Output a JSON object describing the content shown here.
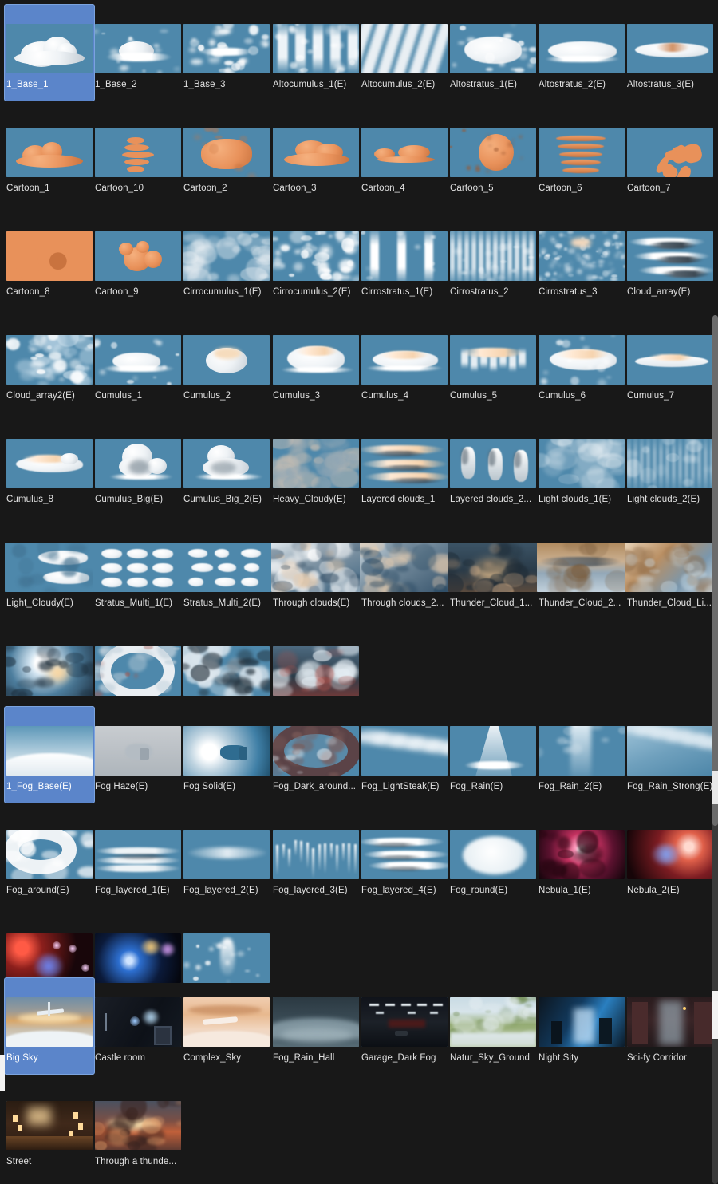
{
  "app": {
    "view": "asset-grid",
    "background_color": "#181818",
    "selection_color": "#5b85ca",
    "label_color": "#e2e2e2",
    "thumbnail_sky_color": "#4e88ab"
  },
  "scrollbar": {
    "visible": true,
    "track_color": "#3a3a3a",
    "thumb_color": "#6b6b6b"
  },
  "sections": [
    {
      "name": "clouds",
      "rows": [
        {
          "items": [
            {
              "label": "1_Base_1",
              "selected": true,
              "art": "cumulus-white"
            },
            {
              "label": "1_Base_2",
              "selected": false,
              "art": "cumulus-flat"
            },
            {
              "label": "1_Base_3",
              "selected": false,
              "art": "cumulus-wispy"
            },
            {
              "label": "Altocumulus_1(E)",
              "selected": false,
              "art": "altocumulus-streaks"
            },
            {
              "label": "Altocumulus_2(E)",
              "selected": false,
              "art": "altocumulus-diag"
            },
            {
              "label": "Altostratus_1(E)",
              "selected": false,
              "art": "altostratus-puff"
            },
            {
              "label": "Altostratus_2(E)",
              "selected": false,
              "art": "altostratus-long"
            },
            {
              "label": "Altostratus_3(E)",
              "selected": false,
              "art": "altostratus-warm"
            }
          ]
        },
        {
          "items": [
            {
              "label": "Cartoon_1",
              "selected": false,
              "art": "cartoon-lumps"
            },
            {
              "label": "Cartoon_10",
              "selected": false,
              "art": "cartoon-stack-ball"
            },
            {
              "label": "Cartoon_2",
              "selected": false,
              "art": "cartoon-mass"
            },
            {
              "label": "Cartoon_3",
              "selected": false,
              "art": "cartoon-rolls"
            },
            {
              "label": "Cartoon_4",
              "selected": false,
              "art": "cartoon-flat"
            },
            {
              "label": "Cartoon_5",
              "selected": false,
              "art": "cartoon-sphere"
            },
            {
              "label": "Cartoon_6",
              "selected": false,
              "art": "cartoon-layers"
            },
            {
              "label": "Cartoon_7",
              "selected": false,
              "art": "cartoon-tangle"
            }
          ]
        },
        {
          "items": [
            {
              "label": "Cartoon_8",
              "selected": false,
              "art": "cartoon-swirl"
            },
            {
              "label": "Cartoon_9",
              "selected": false,
              "art": "cartoon-bubbles"
            },
            {
              "label": "Cirrocumulus_1(E)",
              "selected": false,
              "art": "cirro-soft"
            },
            {
              "label": "Cirrocumulus_2(E)",
              "selected": false,
              "art": "cirro-patchy"
            },
            {
              "label": "Cirrostratus_1(E)",
              "selected": false,
              "art": "cirro-vertical3"
            },
            {
              "label": "Cirrostratus_2",
              "selected": false,
              "art": "cirro-ripple"
            },
            {
              "label": "Cirrostratus_3",
              "selected": false,
              "art": "cirro-fine"
            },
            {
              "label": "Cloud_array(E)",
              "selected": false,
              "art": "cloud-array"
            }
          ]
        },
        {
          "items": [
            {
              "label": "Cloud_array2(E)",
              "selected": false,
              "art": "cloud-array2"
            },
            {
              "label": "Cumulus_1",
              "selected": false,
              "art": "cumulus-low"
            },
            {
              "label": "Cumulus_2",
              "selected": false,
              "art": "cumulus-round"
            },
            {
              "label": "Cumulus_3",
              "selected": false,
              "art": "cumulus-fluffy"
            },
            {
              "label": "Cumulus_4",
              "selected": false,
              "art": "cumulus-wide"
            },
            {
              "label": "Cumulus_5",
              "selected": false,
              "art": "cumulus-tufted"
            },
            {
              "label": "Cumulus_6",
              "selected": false,
              "art": "cumulus-broad"
            },
            {
              "label": "Cumulus_7",
              "selected": false,
              "art": "cumulus-lens"
            }
          ]
        },
        {
          "items": [
            {
              "label": "Cumulus_8",
              "selected": false,
              "art": "cumulus-warm-flat"
            },
            {
              "label": "Cumulus_Big(E)",
              "selected": false,
              "art": "cumulus-tower"
            },
            {
              "label": "Cumulus_Big_2(E)",
              "selected": false,
              "art": "cumulus-tower2"
            },
            {
              "label": "Heavy_Cloudy(E)",
              "selected": false,
              "art": "heavy-cloudy"
            },
            {
              "label": "Layered clouds_1",
              "selected": false,
              "art": "layered-1"
            },
            {
              "label": "Layered clouds_2...",
              "selected": false,
              "art": "layered-2"
            },
            {
              "label": "Light clouds_1(E)",
              "selected": false,
              "art": "light-clouds-1"
            },
            {
              "label": "Light clouds_2(E)",
              "selected": false,
              "art": "light-clouds-2"
            }
          ]
        },
        {
          "items": [
            {
              "label": "Light_Cloudy(E)",
              "selected": false,
              "art": "light-cloudy"
            },
            {
              "label": "Stratus_Multi_1(E)",
              "selected": false,
              "art": "stratus-multi-1"
            },
            {
              "label": "Stratus_Multi_2(E)",
              "selected": false,
              "art": "stratus-multi-2"
            },
            {
              "label": "Through clouds(E)",
              "selected": false,
              "art": "through-clouds"
            },
            {
              "label": "Through clouds_2...",
              "selected": false,
              "art": "through-clouds-2"
            },
            {
              "label": "Thunder_Cloud_1...",
              "selected": false,
              "art": "thunder-1"
            },
            {
              "label": "Thunder_Cloud_2...",
              "selected": false,
              "art": "thunder-2"
            },
            {
              "label": "Thunder_Cloud_Li...",
              "selected": false,
              "art": "thunder-light"
            }
          ]
        },
        {
          "no_labels": true,
          "items": [
            {
              "label": "",
              "selected": false,
              "art": "sun-burst"
            },
            {
              "label": "",
              "selected": false,
              "art": "fog-ring"
            },
            {
              "label": "",
              "selected": false,
              "art": "fog-holes"
            },
            {
              "label": "",
              "selected": false,
              "art": "fog-red-glow"
            }
          ]
        }
      ]
    },
    {
      "name": "fog",
      "rows": [
        {
          "items": [
            {
              "label": "1_Fog_Base(E)",
              "selected": true,
              "art": "fog-base"
            },
            {
              "label": "Fog Haze(E)",
              "selected": false,
              "art": "fog-haze"
            },
            {
              "label": "Fog Solid(E)",
              "selected": false,
              "art": "fog-solid"
            },
            {
              "label": "Fog_Dark_around...",
              "selected": false,
              "art": "fog-dark-around"
            },
            {
              "label": "Fog_LightSteak(E)",
              "selected": false,
              "art": "fog-light-streak"
            },
            {
              "label": "Fog_Rain(E)",
              "selected": false,
              "art": "fog-rain"
            },
            {
              "label": "Fog_Rain_2(E)",
              "selected": false,
              "art": "fog-rain-2"
            },
            {
              "label": "Fog_Rain_Strong(E)",
              "selected": false,
              "art": "fog-rain-strong"
            }
          ]
        },
        {
          "items": [
            {
              "label": "Fog_around(E)",
              "selected": false,
              "art": "fog-around"
            },
            {
              "label": "Fog_layered_1(E)",
              "selected": false,
              "art": "fog-layered-1"
            },
            {
              "label": "Fog_layered_2(E)",
              "selected": false,
              "art": "fog-layered-2"
            },
            {
              "label": "Fog_layered_3(E)",
              "selected": false,
              "art": "fog-layered-3"
            },
            {
              "label": "Fog_layered_4(E)",
              "selected": false,
              "art": "fog-layered-4"
            },
            {
              "label": "Fog_round(E)",
              "selected": false,
              "art": "fog-round"
            },
            {
              "label": "Nebula_1(E)",
              "selected": false,
              "art": "nebula-1"
            },
            {
              "label": "Nebula_2(E)",
              "selected": false,
              "art": "nebula-2"
            }
          ]
        },
        {
          "no_labels": true,
          "items": [
            {
              "label": "",
              "selected": false,
              "art": "nebula-3"
            },
            {
              "label": "",
              "selected": false,
              "art": "nebula-4"
            },
            {
              "label": "",
              "selected": false,
              "art": "spray-plume"
            }
          ]
        }
      ]
    },
    {
      "name": "maps",
      "rows": [
        {
          "items": [
            {
              "label": "Big Sky",
              "selected": true,
              "art": "big-sky"
            },
            {
              "label": "Castle room",
              "selected": false,
              "art": "castle-room"
            },
            {
              "label": "Complex_Sky",
              "selected": false,
              "art": "complex-sky"
            },
            {
              "label": "Fog_Rain_Hall",
              "selected": false,
              "art": "fog-rain-hall"
            },
            {
              "label": "Garage_Dark Fog",
              "selected": false,
              "art": "garage-dark-fog"
            },
            {
              "label": "Natur_Sky_Ground",
              "selected": false,
              "art": "nature-sky-ground"
            },
            {
              "label": "Night Sity",
              "selected": false,
              "art": "night-city"
            },
            {
              "label": "Sci-fy Corridor",
              "selected": false,
              "art": "scifi-corridor"
            }
          ]
        },
        {
          "items": [
            {
              "label": "Street",
              "selected": false,
              "art": "street"
            },
            {
              "label": "Through a thunde...",
              "selected": false,
              "art": "through-thunder"
            }
          ]
        }
      ]
    }
  ]
}
